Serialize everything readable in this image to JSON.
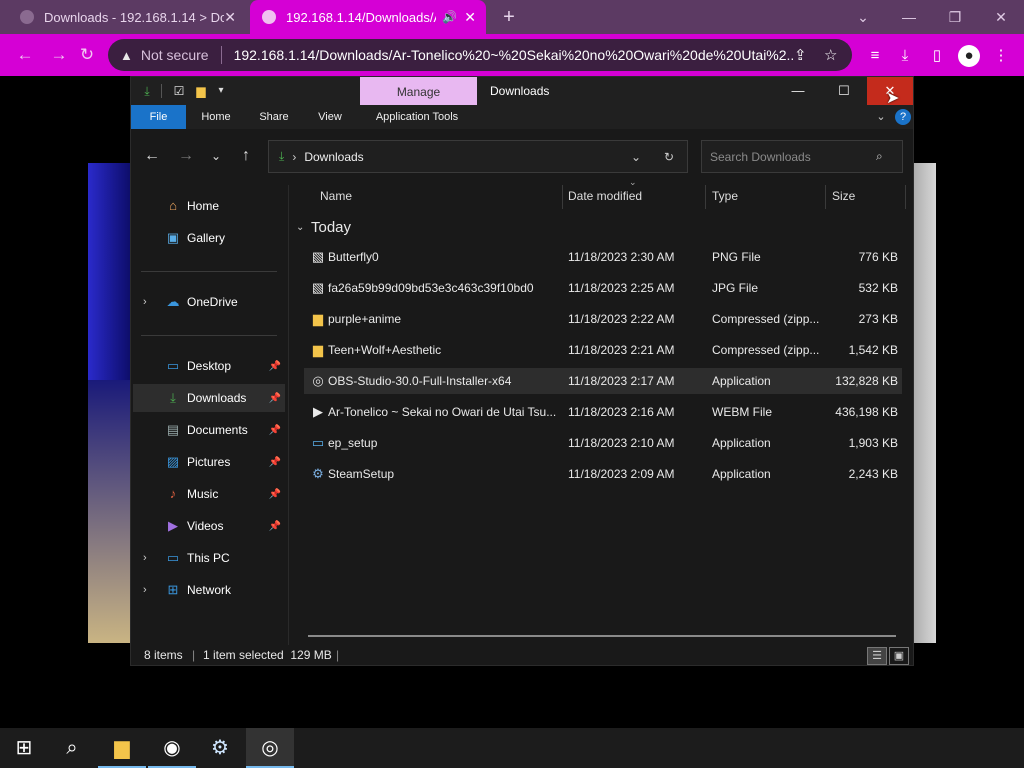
{
  "browser": {
    "tabs": [
      {
        "title": "Downloads - 192.168.1.14 > Do",
        "active": false
      },
      {
        "title": "192.168.1.14/Downloads/Ar",
        "active": true
      }
    ],
    "security_label": "Not secure",
    "url": "192.168.1.14/Downloads/Ar-Tonelico%20~%20Sekai%20no%20Owari%20de%20Utai%2...",
    "accent_color": "#d500d5"
  },
  "explorer": {
    "title": "Downloads",
    "context_tab": "Manage",
    "ribbon_tabs": [
      "File",
      "Home",
      "Share",
      "View",
      "Application Tools"
    ],
    "address": "Downloads",
    "search_placeholder": "Search Downloads",
    "nav": {
      "home": "Home",
      "gallery": "Gallery",
      "onedrive": "OneDrive",
      "desktop": "Desktop",
      "downloads": "Downloads",
      "documents": "Documents",
      "pictures": "Pictures",
      "music": "Music",
      "videos": "Videos",
      "thispc": "This PC",
      "network": "Network"
    },
    "columns": {
      "name": "Name",
      "date": "Date modified",
      "type": "Type",
      "size": "Size"
    },
    "group": "Today",
    "files": [
      {
        "name": "Butterfly0",
        "date": "11/18/2023 2:30 AM",
        "type": "PNG File",
        "size": "776 KB",
        "icon": "image-file-icon"
      },
      {
        "name": "fa26a59b99d09bd53e3c463c39f10bd0",
        "date": "11/18/2023 2:25 AM",
        "type": "JPG File",
        "size": "532 KB",
        "icon": "image-file-icon"
      },
      {
        "name": "purple+anime",
        "date": "11/18/2023 2:22 AM",
        "type": "Compressed (zipp...",
        "size": "273 KB",
        "icon": "zip-folder-icon"
      },
      {
        "name": "Teen+Wolf+Aesthetic",
        "date": "11/18/2023 2:21 AM",
        "type": "Compressed (zipp...",
        "size": "1,542 KB",
        "icon": "zip-folder-icon"
      },
      {
        "name": "OBS-Studio-30.0-Full-Installer-x64",
        "date": "11/18/2023 2:17 AM",
        "type": "Application",
        "size": "132,828 KB",
        "icon": "obs-icon"
      },
      {
        "name": "Ar-Tonelico ~ Sekai no Owari de Utai Tsu...",
        "date": "11/18/2023 2:16 AM",
        "type": "WEBM File",
        "size": "436,198 KB",
        "icon": "video-file-icon"
      },
      {
        "name": "ep_setup",
        "date": "11/18/2023 2:10 AM",
        "type": "Application",
        "size": "1,903 KB",
        "icon": "app-icon"
      },
      {
        "name": "SteamSetup",
        "date": "11/18/2023 2:09 AM",
        "type": "Application",
        "size": "2,243 KB",
        "icon": "steam-icon"
      }
    ],
    "status": {
      "count": "8 items",
      "selection": "1 item selected  129 MB"
    }
  }
}
